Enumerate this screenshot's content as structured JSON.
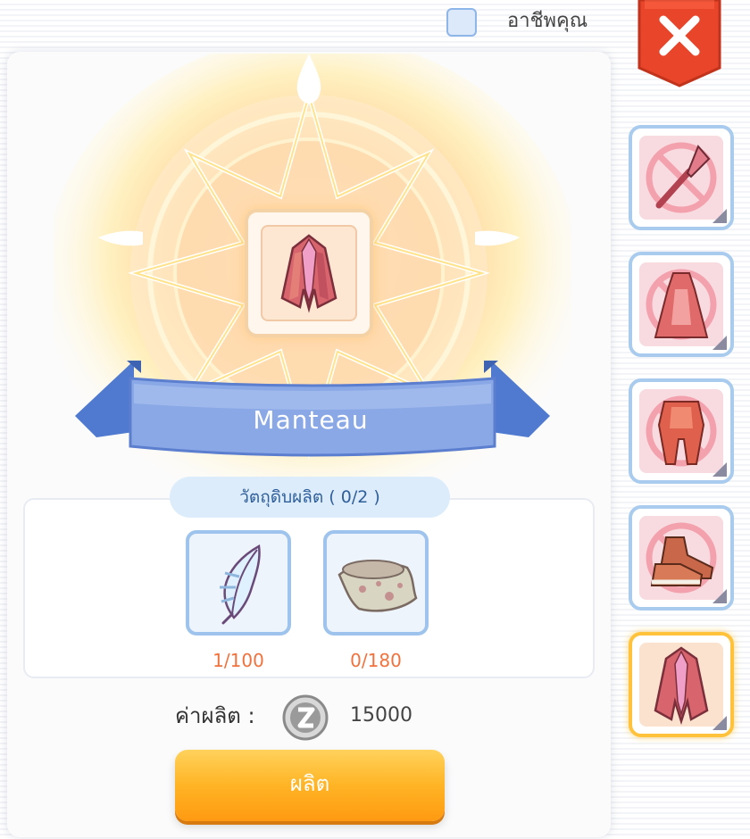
{
  "header": {
    "job_filter_label": "อาชีพคุณ",
    "job_filter_checked": false,
    "close_icon": "close-icon"
  },
  "item": {
    "name": "Manteau",
    "icon": "manteau-icon"
  },
  "materials": {
    "header": "วัตถุดิบผลิต ( 0/2 )",
    "items": [
      {
        "icon": "feather-icon",
        "count": "1/100"
      },
      {
        "icon": "cloth-icon",
        "count": "0/180"
      }
    ]
  },
  "cost": {
    "label": "ค่าผลิต :",
    "currency_icon": "zeny-coin-icon",
    "value": "15000"
  },
  "craft_button": {
    "label": "ผลิต"
  },
  "equipment_slots": [
    {
      "icon": "spear-icon",
      "locked": true,
      "selected": false
    },
    {
      "icon": "dress-icon",
      "locked": true,
      "selected": false
    },
    {
      "icon": "armor-icon",
      "locked": true,
      "selected": false
    },
    {
      "icon": "shoes-icon",
      "locked": true,
      "selected": false
    },
    {
      "icon": "manteau-icon",
      "locked": false,
      "selected": true
    }
  ],
  "colors": {
    "accent_orange": "#ff9a12",
    "count_red": "#f1723c",
    "ribbon_blue": "#7f9fde",
    "close_red": "#e8452a"
  }
}
